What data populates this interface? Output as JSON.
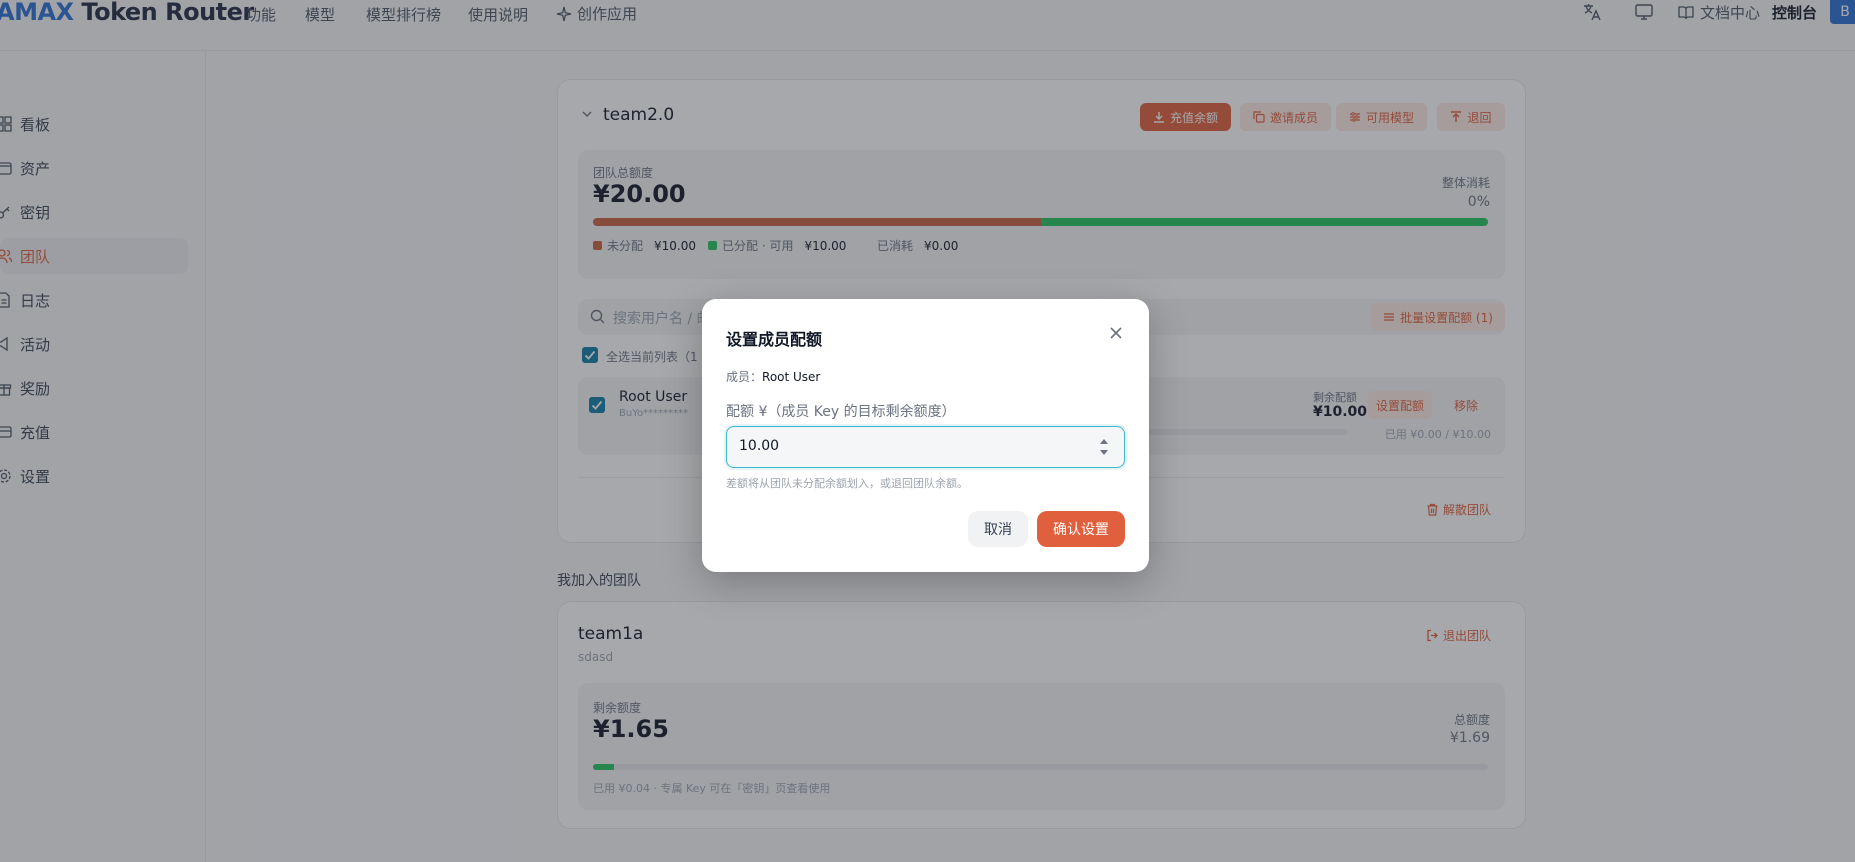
{
  "brand": {
    "prefix": "AMAX",
    "suffix": "Token Router"
  },
  "topnav": {
    "items": [
      "功能",
      "模型",
      "模型排行榜",
      "使用说明",
      "创作应用"
    ],
    "docs": "文档中心",
    "console": "控制台",
    "avatar": "B"
  },
  "sidebar": {
    "items": [
      {
        "label": "看板",
        "icon": "dashboard-icon"
      },
      {
        "label": "资产",
        "icon": "wallet-icon"
      },
      {
        "label": "密钥",
        "icon": "key-icon"
      },
      {
        "label": "团队",
        "icon": "users-icon",
        "active": true
      },
      {
        "label": "日志",
        "icon": "log-icon"
      },
      {
        "label": "活动",
        "icon": "megaphone-icon"
      },
      {
        "label": "奖励",
        "icon": "gift-icon"
      },
      {
        "label": "充值",
        "icon": "card-icon"
      },
      {
        "label": "设置",
        "icon": "gear-icon"
      }
    ]
  },
  "team_main": {
    "name": "team2.0",
    "actions": {
      "recharge": "充值余额",
      "invite": "邀请成员",
      "models": "可用模型",
      "exit": "退回"
    },
    "total_label": "团队总额度",
    "total_amount": "¥20.00",
    "overall_label": "整体消耗",
    "overall_value": "0%",
    "progress": {
      "unallocated_fraction": 0.5,
      "allocated_fraction": 0.5
    },
    "legend": {
      "unallocated_label": "未分配",
      "unallocated_value": "¥10.00",
      "allocated_label": "已分配 · 可用",
      "allocated_value": "¥10.00",
      "consumed_label": "已消耗",
      "consumed_value": "¥0.00"
    },
    "search_placeholder": "搜索用户名 / 邮",
    "batch_button": "批量设置配额 (1)",
    "select_all": "全选当前列表（1",
    "member": {
      "name": "Root User",
      "key": "BuYo*********",
      "remaining_label": "剩余配额",
      "remaining_value": "¥10.00",
      "set_quota": "设置配额",
      "remove": "移除",
      "used_text": "已用 ¥0.00 / ¥10.00",
      "used_fraction": 0
    },
    "dissolve": "解散团队"
  },
  "joined_section_title": "我加入的团队",
  "team_joined": {
    "name": "team1a",
    "desc": "sdasd",
    "leave": "退出团队",
    "remaining_label": "剩余额度",
    "remaining_amount": "¥1.65",
    "total_label": "总额度",
    "total_amount": "¥1.69",
    "used_fraction": 0.024,
    "footer": "已用 ¥0.04 · 专属 Key 可在「密钥」页查看使用"
  },
  "modal": {
    "title": "设置成员配额",
    "member_label": "成员：",
    "member_value": "Root User",
    "field_label": "配额 ¥（成员 Key 的目标剩余额度）",
    "input_value": "10.00",
    "hint": "差额将从团队未分配余额划入，或退回团队余额。",
    "cancel": "取消",
    "confirm": "确认设置"
  },
  "colors": {
    "accent": "#e0603d",
    "green": "#22c55e",
    "focus": "#3fb8c8"
  }
}
